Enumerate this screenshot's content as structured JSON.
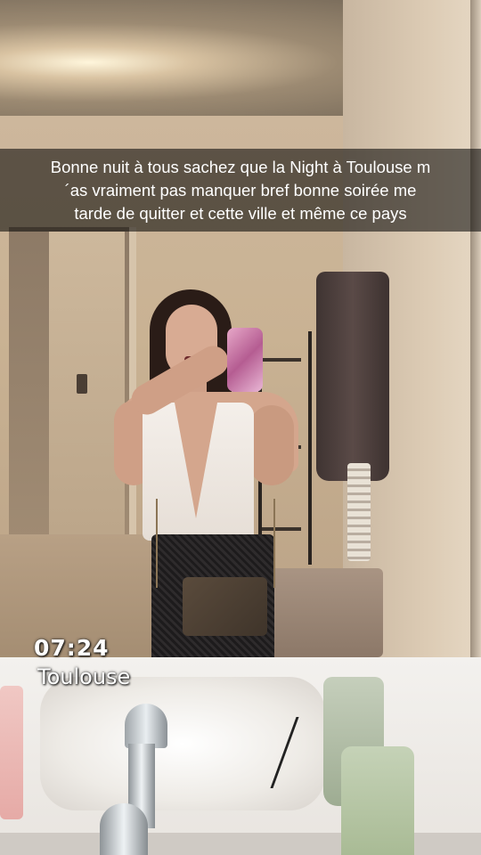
{
  "caption": {
    "lines": [
      "Bonne nuit à tous sachez que la Night à Toulouse m",
      "´as vraiment pas manquer bref bonne soirée me",
      "tarde de quitter et cette ville et même ce pays"
    ]
  },
  "sticker": {
    "time": "07:24",
    "location": "Toulouse"
  }
}
